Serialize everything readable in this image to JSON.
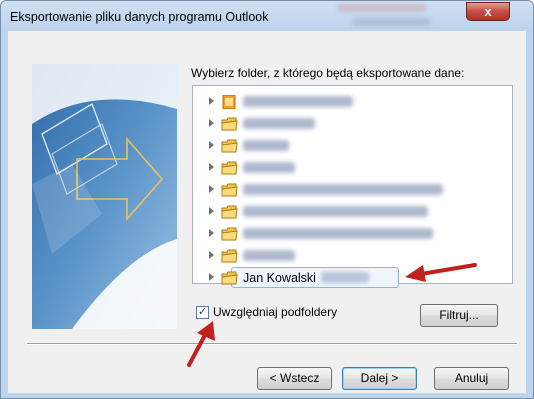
{
  "window": {
    "title": "Eksportowanie pliku danych programu Outlook",
    "close_label": "x"
  },
  "prompt": "Wybierz folder, z którego będą eksportowane dane:",
  "folders": [
    {
      "label": "",
      "icon": "outlook-data-icon"
    },
    {
      "label": "",
      "icon": "folder-icon"
    },
    {
      "label": "",
      "icon": "folder-icon"
    },
    {
      "label": "",
      "icon": "folder-icon"
    },
    {
      "label": "",
      "icon": "folder-icon"
    },
    {
      "label": "",
      "icon": "folder-icon"
    },
    {
      "label": "",
      "icon": "folder-icon"
    },
    {
      "label": "",
      "icon": "folder-icon"
    },
    {
      "label": "Jan Kowalski",
      "icon": "folder-icon",
      "selected": true
    }
  ],
  "include_subfolders": {
    "label": "Uwzględniaj podfoldery",
    "checked": true,
    "mark": "✓"
  },
  "buttons": {
    "filter": "Filtruj...",
    "back": "< Wstecz",
    "next": "Dalej >",
    "cancel": "Anuluj"
  },
  "colors": {
    "arrow": "#c0211f",
    "selection_border": "#8cb4e0",
    "close_button": "#c75050"
  }
}
